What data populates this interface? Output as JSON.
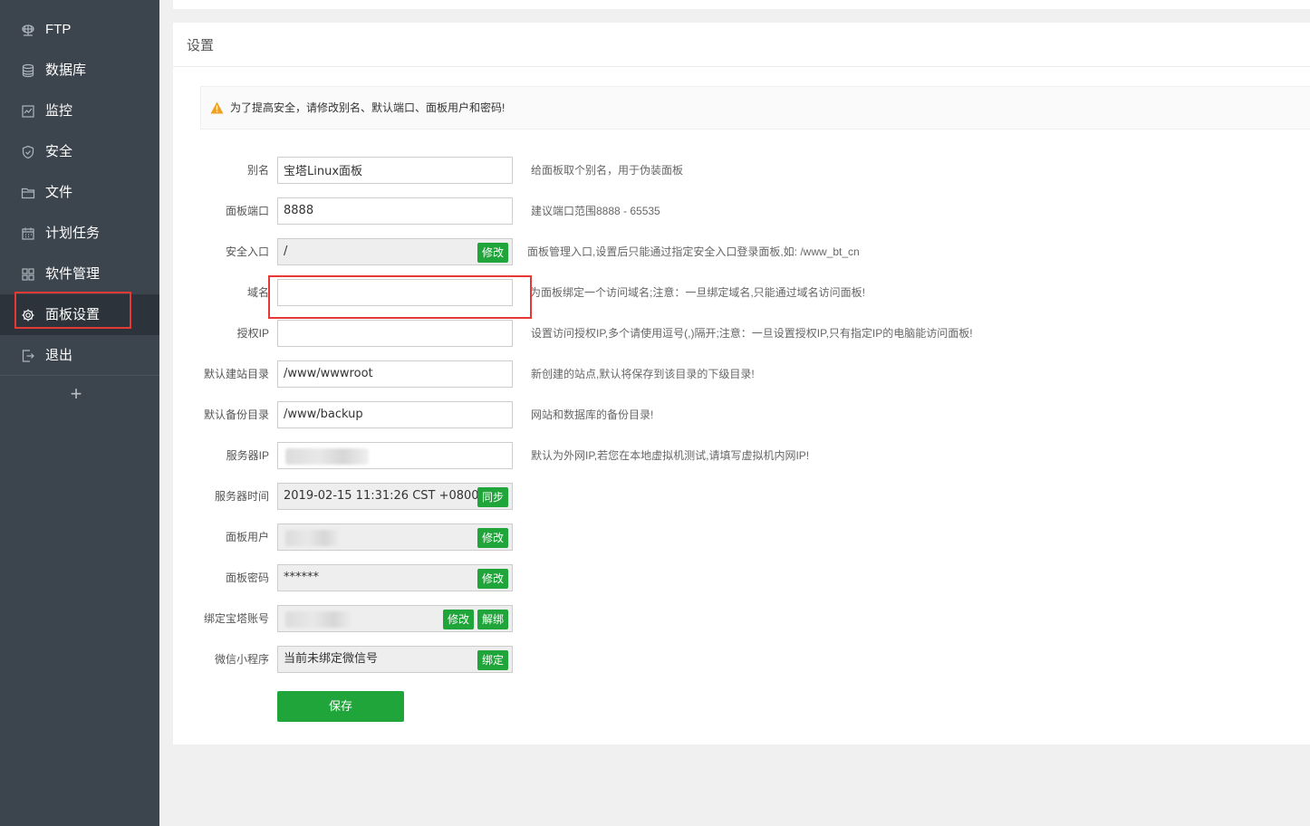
{
  "sidebar": {
    "items": [
      {
        "label": "FTP",
        "icon": "globe-icon"
      },
      {
        "label": "数据库",
        "icon": "database-icon"
      },
      {
        "label": "监控",
        "icon": "monitor-icon"
      },
      {
        "label": "安全",
        "icon": "shield-icon"
      },
      {
        "label": "文件",
        "icon": "folder-icon"
      },
      {
        "label": "计划任务",
        "icon": "calendar-icon"
      },
      {
        "label": "软件管理",
        "icon": "grid-icon"
      },
      {
        "label": "面板设置",
        "icon": "gear-icon",
        "active": true
      },
      {
        "label": "退出",
        "icon": "logout-icon"
      }
    ],
    "add_symbol": "+"
  },
  "panel": {
    "title": "设置",
    "alert": "为了提高安全，请修改别名、默认端口、面板用户和密码!",
    "save_label": "保存"
  },
  "form": {
    "alias": {
      "label": "别名",
      "value": "宝塔Linux面板",
      "hint": "给面板取个别名，用于伪装面板"
    },
    "port": {
      "label": "面板端口",
      "value": "8888",
      "hint": "建议端口范围8888 - 65535"
    },
    "entry": {
      "label": "安全入口",
      "value": "/",
      "button": "修改",
      "hint": "面板管理入口,设置后只能通过指定安全入口登录面板,如: /www_bt_cn"
    },
    "domain": {
      "label": "域名",
      "value": "",
      "hint": "为面板绑定一个访问域名;注意：一旦绑定域名,只能通过域名访问面板!"
    },
    "auth_ip": {
      "label": "授权IP",
      "value": "",
      "hint": "设置访问授权IP,多个请使用逗号(,)隔开;注意：一旦设置授权IP,只有指定IP的电脑能访问面板!"
    },
    "site_dir": {
      "label": "默认建站目录",
      "value": "/www/wwwroot",
      "hint": "新创建的站点,默认将保存到该目录的下级目录!"
    },
    "backup_dir": {
      "label": "默认备份目录",
      "value": "/www/backup",
      "hint": "网站和数据库的备份目录!"
    },
    "server_ip": {
      "label": "服务器IP",
      "hint": "默认为外网IP,若您在本地虚拟机测试,请填写虚拟机内网IP!"
    },
    "server_time": {
      "label": "服务器时间",
      "value": "2019-02-15 11:31:26 CST +0800",
      "button": "同步"
    },
    "panel_user": {
      "label": "面板用户",
      "button": "修改"
    },
    "panel_password": {
      "label": "面板密码",
      "value": "******",
      "button": "修改"
    },
    "bt_account": {
      "label": "绑定宝塔账号",
      "button_modify": "修改",
      "button_unbind": "解绑"
    },
    "wechat": {
      "label": "微信小程序",
      "value": "当前未绑定微信号",
      "button": "绑定"
    }
  },
  "colors": {
    "sidebar_bg": "#3c444d",
    "sidebar_active_bg": "#2c333a",
    "accent_green": "#20a53a",
    "highlight_red": "#e53935",
    "warning_orange": "#f0a020"
  }
}
